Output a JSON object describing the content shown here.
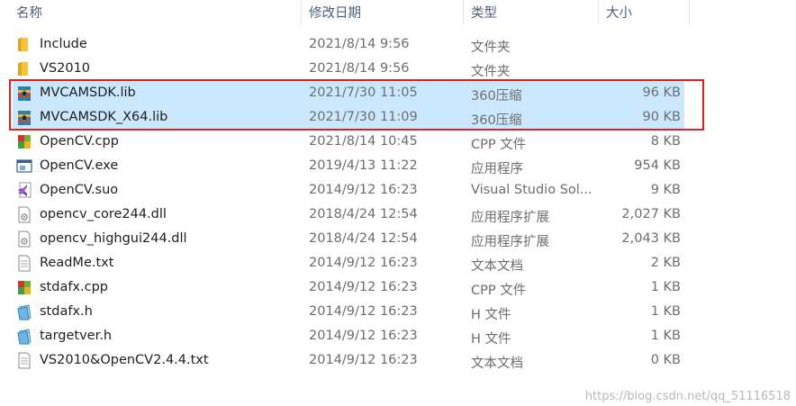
{
  "columns": {
    "name": "名称",
    "date": "修改日期",
    "type": "类型",
    "size": "大小"
  },
  "sort_glyph": "^",
  "files": [
    {
      "icon": "folder-icon",
      "name": "Include",
      "date": "2021/8/14 9:56",
      "type": "文件夹",
      "size": ""
    },
    {
      "icon": "folder-icon",
      "name": "VS2010",
      "date": "2021/8/14 9:56",
      "type": "文件夹",
      "size": ""
    },
    {
      "icon": "archive-icon",
      "name": "MVCAMSDK.lib",
      "date": "2021/7/30 11:05",
      "type": "360压缩",
      "size": "96 KB"
    },
    {
      "icon": "archive-icon",
      "name": "MVCAMSDK_X64.lib",
      "date": "2021/7/30 11:09",
      "type": "360压缩",
      "size": "90 KB"
    },
    {
      "icon": "cpp-file-icon",
      "name": "OpenCV.cpp",
      "date": "2021/8/14 10:45",
      "type": "CPP 文件",
      "size": "8 KB"
    },
    {
      "icon": "exe-icon",
      "name": "OpenCV.exe",
      "date": "2019/4/13 11:22",
      "type": "应用程序",
      "size": "954 KB"
    },
    {
      "icon": "vs-suo-icon",
      "name": "OpenCV.suo",
      "date": "2014/9/12 16:23",
      "type": "Visual Studio Sol...",
      "size": "9 KB"
    },
    {
      "icon": "dll-icon",
      "name": "opencv_core244.dll",
      "date": "2018/4/24 12:54",
      "type": "应用程序扩展",
      "size": "2,027 KB"
    },
    {
      "icon": "dll-icon",
      "name": "opencv_highgui244.dll",
      "date": "2018/4/24 12:54",
      "type": "应用程序扩展",
      "size": "2,043 KB"
    },
    {
      "icon": "text-file-icon",
      "name": "ReadMe.txt",
      "date": "2014/9/12 16:23",
      "type": "文本文档",
      "size": "2 KB"
    },
    {
      "icon": "cpp-file-icon",
      "name": "stdafx.cpp",
      "date": "2014/9/12 16:23",
      "type": "CPP 文件",
      "size": "1 KB"
    },
    {
      "icon": "header-file-icon",
      "name": "stdafx.h",
      "date": "2014/9/12 16:23",
      "type": "H 文件",
      "size": "1 KB"
    },
    {
      "icon": "header-file-icon",
      "name": "targetver.h",
      "date": "2014/9/12 16:23",
      "type": "H 文件",
      "size": "1 KB"
    },
    {
      "icon": "text-file-icon",
      "name": "VS2010&OpenCV2.4.4.txt",
      "date": "2014/9/12 16:23",
      "type": "文本文档",
      "size": "0 KB"
    }
  ],
  "watermark": "https://blog.csdn.net/qq_51116518",
  "colors": {
    "selected_row": "#cce8ff",
    "highlight_border": "#e02020",
    "header_text": "#4c607a"
  }
}
